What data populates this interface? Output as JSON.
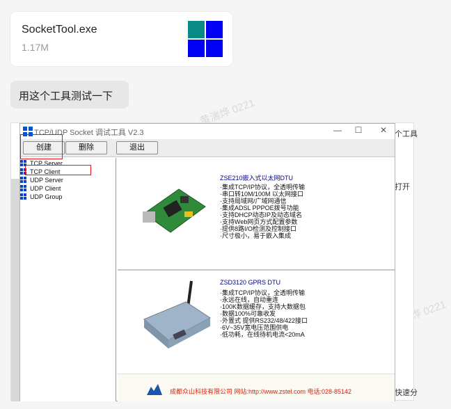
{
  "file": {
    "name": "SocketTool.exe",
    "size": "1.17M",
    "icon": "windows-logo-icon",
    "colors": {
      "teal": "#0b8b86",
      "blue": "#0000f5"
    }
  },
  "message": "用这个工具测试一下",
  "watermark": "黄湍烨 0221",
  "side": {
    "top": "个工具",
    "open": "打开",
    "bottom": "快速分"
  },
  "window": {
    "title": "TCP/UDP Socket 调试工具 V2.3",
    "controls": {
      "min": "—",
      "max": "☐",
      "close": "✕"
    },
    "toolbar": {
      "create": "创建",
      "delete": "删除",
      "exit": "退出"
    },
    "tree": [
      "TCP Server",
      "TCP Client",
      "UDP Server",
      "UDP Client",
      "UDP Group"
    ],
    "ads": [
      {
        "title": "ZSE210嵌入式以太网DTU",
        "lines": "·集成TCP/IP协议，全透明传输\n·串口转10M/100M 以太网接口\n·支持局域网/广域网通信\n·集成ADSL PPPOE拨号功能\n·支持DHCP动态IP及动态域名\n·支持Web网页方式配置参数\n·提供8路I/O检测及控制接口\n·尺寸极小，易于嵌入集成"
      },
      {
        "title": "ZSD3120 GPRS DTU",
        "lines": "·集成TCP/IP协议，全透明传输\n·永远在线，自动重连\n·100K数据缓存，支持大数据包\n·数据100%可靠收发\n·外置式 提供RS232/48/422接口\n·6V~35V宽电压范围供电\n·低功耗，在线待机电流<20mA"
      }
    ],
    "footer": "成都众山科技有限公司  网站:http://www.zstel.com  电话:028-85142"
  }
}
